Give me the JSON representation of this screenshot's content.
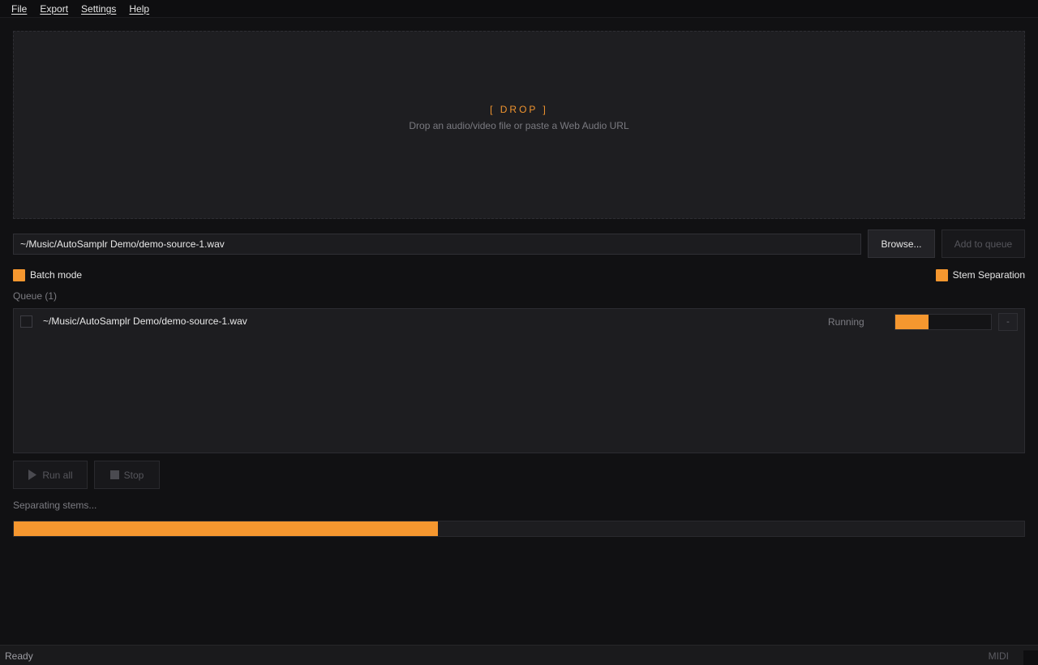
{
  "menu": {
    "file": "File",
    "export": "Export",
    "settings": "Settings",
    "help": "Help"
  },
  "dropzone": {
    "title": "[ DROP ]",
    "subtitle": "Drop an audio/video file or paste a Web Audio URL"
  },
  "source": {
    "path_value": "~/Music/AutoSamplr Demo/demo-source-1.wav",
    "browse_label": "Browse...",
    "add_queue_label": "Add to queue"
  },
  "options": {
    "batch_mode_label": "Batch mode",
    "batch_mode_checked": true,
    "stem_separation_label": "Stem Separation",
    "stem_separation_checked": true
  },
  "queue": {
    "label": "Queue (1)",
    "items": [
      {
        "path": "~/Music/AutoSamplr Demo/demo-source-1.wav",
        "status": "Running",
        "progress": 0.35,
        "remove_label": "-"
      }
    ]
  },
  "controls": {
    "run_all_label": "Run all",
    "stop_label": "Stop"
  },
  "job": {
    "status_text": "Separating stems...",
    "progress": 0.42
  },
  "statusbar": {
    "status": "Ready",
    "midi": "MIDI"
  },
  "colors": {
    "accent": "#f5972f",
    "background": "#111113",
    "panel": "#1e1e21"
  },
  "icons": {
    "run_all": "play-icon",
    "stop": "stop-icon"
  }
}
